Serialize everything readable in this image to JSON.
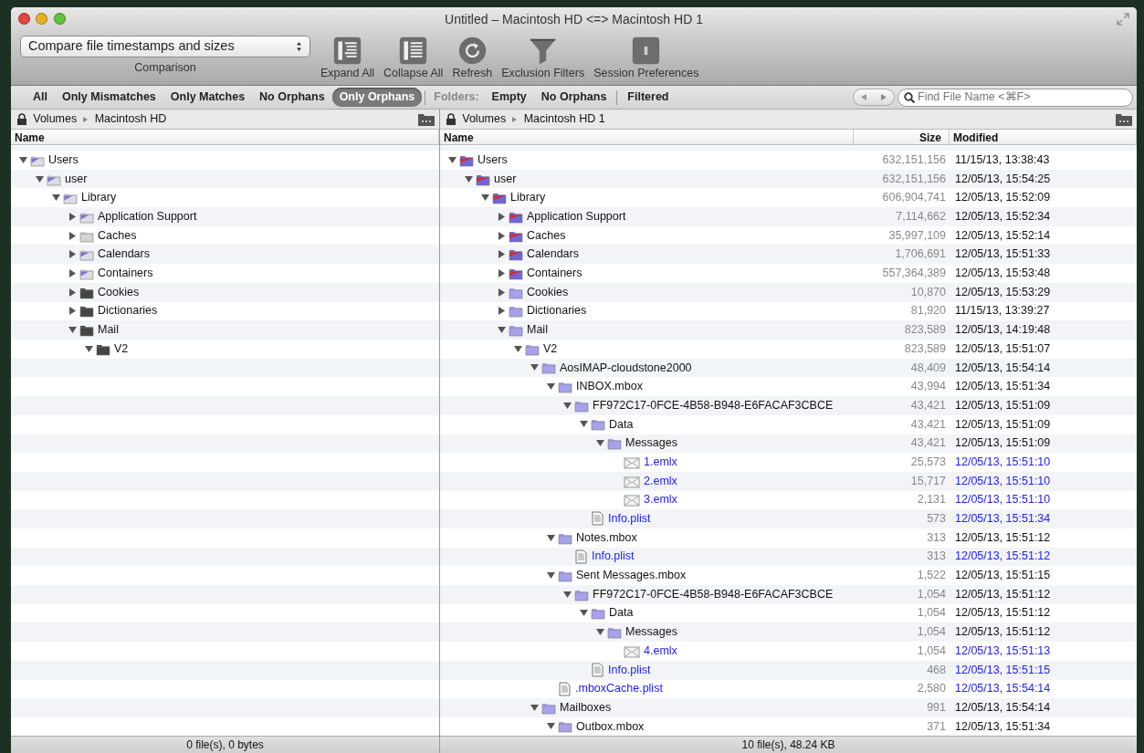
{
  "window": {
    "title": "Untitled – Macintosh HD <=> Macintosh HD 1"
  },
  "toolbar": {
    "comparison": {
      "value": "Compare file timestamps and sizes",
      "label": "Comparison"
    },
    "buttons": [
      {
        "label": "Expand All",
        "kind": "expand"
      },
      {
        "label": "Collapse All",
        "kind": "collapse"
      },
      {
        "label": "Refresh",
        "kind": "refresh"
      },
      {
        "label": "Exclusion Filters",
        "kind": "filter"
      },
      {
        "label": "Session Preferences",
        "kind": "prefs"
      }
    ]
  },
  "filter_bar": {
    "filters": [
      {
        "label": "All",
        "selected": false
      },
      {
        "label": "Only Mismatches",
        "selected": false
      },
      {
        "label": "Only Matches",
        "selected": false
      },
      {
        "label": "No Orphans",
        "selected": false
      },
      {
        "label": "Only Orphans",
        "selected": true
      }
    ],
    "folders_label": "Folders:",
    "folder_filters": [
      {
        "label": "Empty",
        "selected": false
      },
      {
        "label": "No Orphans",
        "selected": false
      }
    ],
    "extra_filters": [
      {
        "label": "Filtered",
        "selected": false
      }
    ],
    "search": {
      "placeholder": "Find File Name <⌘F>"
    }
  },
  "left_pane": {
    "path": [
      "Volumes",
      "Macintosh HD"
    ],
    "columns": [
      "Name"
    ],
    "tree": [
      {
        "name": "Users",
        "kind": "folder",
        "color": "#dcdce4",
        "mismatched": true,
        "expanded": true,
        "children": [
          {
            "name": "user",
            "kind": "folder",
            "color": "#dcdce4",
            "mismatched": true,
            "expanded": true,
            "children": [
              {
                "name": "Library",
                "kind": "folder",
                "color": "#dcdce4",
                "mismatched": true,
                "expanded": true,
                "children": [
                  {
                    "name": "Application Support",
                    "kind": "folder",
                    "color": "#dcdce4",
                    "mismatched": true,
                    "expanded": false
                  },
                  {
                    "name": "Caches",
                    "kind": "folder",
                    "color": "#d4d4d4",
                    "mismatched": false,
                    "expanded": false
                  },
                  {
                    "name": "Calendars",
                    "kind": "folder",
                    "color": "#dcdce4",
                    "mismatched": true,
                    "expanded": false
                  },
                  {
                    "name": "Containers",
                    "kind": "folder",
                    "color": "#dcdce4",
                    "mismatched": true,
                    "expanded": false
                  },
                  {
                    "name": "Cookies",
                    "kind": "folder",
                    "color": "#444444",
                    "mismatched": false,
                    "expanded": false
                  },
                  {
                    "name": "Dictionaries",
                    "kind": "folder",
                    "color": "#444444",
                    "mismatched": false,
                    "expanded": false
                  },
                  {
                    "name": "Mail",
                    "kind": "folder",
                    "color": "#444444",
                    "mismatched": false,
                    "expanded": true,
                    "children": [
                      {
                        "name": "V2",
                        "kind": "folder",
                        "color": "#444444",
                        "mismatched": false,
                        "expanded": true
                      }
                    ]
                  }
                ]
              }
            ]
          }
        ]
      }
    ],
    "status": "0 file(s), 0 bytes"
  },
  "right_pane": {
    "path": [
      "Volumes",
      "Macintosh HD 1"
    ],
    "columns": [
      "Name",
      "Size",
      "Modified"
    ],
    "tree": [
      {
        "name": "Users",
        "kind": "folder",
        "color": "#6f66d8",
        "mismatched": true,
        "expanded": true,
        "orphan": false,
        "size": "632,151,156",
        "modified": "11/15/13, 13:38:43",
        "children": [
          {
            "name": "user",
            "kind": "folder",
            "color": "#6f66d8",
            "mismatched": true,
            "expanded": true,
            "orphan": false,
            "size": "632,151,156",
            "modified": "12/05/13, 15:54:25",
            "children": [
              {
                "name": "Library",
                "kind": "folder",
                "color": "#6f66d8",
                "mismatched": true,
                "expanded": true,
                "orphan": false,
                "size": "606,904,741",
                "modified": "12/05/13, 15:52:09",
                "children": [
                  {
                    "name": "Application Support",
                    "kind": "folder",
                    "color": "#6f66d8",
                    "mismatched": true,
                    "expanded": false,
                    "orphan": false,
                    "size": "7,114,662",
                    "modified": "12/05/13, 15:52:34"
                  },
                  {
                    "name": "Caches",
                    "kind": "folder",
                    "color": "#6f66d8",
                    "mismatched": true,
                    "expanded": false,
                    "orphan": false,
                    "size": "35,997,109",
                    "modified": "12/05/13, 15:52:14"
                  },
                  {
                    "name": "Calendars",
                    "kind": "folder",
                    "color": "#6f66d8",
                    "mismatched": true,
                    "expanded": false,
                    "orphan": false,
                    "size": "1,706,691",
                    "modified": "12/05/13, 15:51:33"
                  },
                  {
                    "name": "Containers",
                    "kind": "folder",
                    "color": "#6f66d8",
                    "mismatched": true,
                    "expanded": false,
                    "orphan": false,
                    "size": "557,364,389",
                    "modified": "12/05/13, 15:53:48"
                  },
                  {
                    "name": "Cookies",
                    "kind": "folder",
                    "color": "#a7a2ec",
                    "mismatched": false,
                    "expanded": false,
                    "orphan": false,
                    "size": "10,870",
                    "modified": "12/05/13, 15:53:29"
                  },
                  {
                    "name": "Dictionaries",
                    "kind": "folder",
                    "color": "#a7a2ec",
                    "mismatched": false,
                    "expanded": false,
                    "orphan": false,
                    "size": "81,920",
                    "modified": "11/15/13, 13:39:27"
                  },
                  {
                    "name": "Mail",
                    "kind": "folder",
                    "color": "#a7a2ec",
                    "mismatched": false,
                    "expanded": true,
                    "orphan": false,
                    "size": "823,589",
                    "modified": "12/05/13, 14:19:48",
                    "children": [
                      {
                        "name": "V2",
                        "kind": "folder",
                        "color": "#a7a2ec",
                        "mismatched": false,
                        "expanded": true,
                        "orphan": false,
                        "size": "823,589",
                        "modified": "12/05/13, 15:51:07",
                        "children": [
                          {
                            "name": "AosIMAP-cloudstone2000",
                            "kind": "folder",
                            "color": "#a7a2ec",
                            "mismatched": false,
                            "expanded": true,
                            "orphan": false,
                            "size": "48,409",
                            "modified": "12/05/13, 15:54:14",
                            "children": [
                              {
                                "name": "INBOX.mbox",
                                "kind": "folder",
                                "color": "#a7a2ec",
                                "mismatched": false,
                                "expanded": true,
                                "orphan": false,
                                "size": "43,994",
                                "modified": "12/05/13, 15:51:34",
                                "children": [
                                  {
                                    "name": "FF972C17-0FCE-4B58-B948-E6FACAF3CBCE",
                                    "kind": "folder",
                                    "color": "#a7a2ec",
                                    "mismatched": false,
                                    "expanded": true,
                                    "orphan": false,
                                    "size": "43,421",
                                    "modified": "12/05/13, 15:51:09",
                                    "children": [
                                      {
                                        "name": "Data",
                                        "kind": "folder",
                                        "color": "#a7a2ec",
                                        "mismatched": false,
                                        "expanded": true,
                                        "orphan": false,
                                        "size": "43,421",
                                        "modified": "12/05/13, 15:51:09",
                                        "children": [
                                          {
                                            "name": "Messages",
                                            "kind": "folder",
                                            "color": "#a7a2ec",
                                            "mismatched": false,
                                            "expanded": true,
                                            "orphan": false,
                                            "size": "43,421",
                                            "modified": "12/05/13, 15:51:09",
                                            "children": [
                                              {
                                                "name": "1.emlx",
                                                "kind": "mail",
                                                "orphan": true,
                                                "size": "25,573",
                                                "modified": "12/05/13, 15:51:10"
                                              },
                                              {
                                                "name": "2.emlx",
                                                "kind": "mail",
                                                "orphan": true,
                                                "size": "15,717",
                                                "modified": "12/05/13, 15:51:10"
                                              },
                                              {
                                                "name": "3.emlx",
                                                "kind": "mail",
                                                "orphan": true,
                                                "size": "2,131",
                                                "modified": "12/05/13, 15:51:10"
                                              }
                                            ]
                                          }
                                        ]
                                      },
                                      {
                                        "name": "Info.plist",
                                        "kind": "document",
                                        "orphan": true,
                                        "size": "573",
                                        "modified": "12/05/13, 15:51:34"
                                      }
                                    ]
                                  }
                                ]
                              },
                              {
                                "name": "Notes.mbox",
                                "kind": "folder",
                                "color": "#a7a2ec",
                                "mismatched": false,
                                "expanded": true,
                                "orphan": false,
                                "size": "313",
                                "modified": "12/05/13, 15:51:12",
                                "children": [
                                  {
                                    "name": "Info.plist",
                                    "kind": "document",
                                    "orphan": true,
                                    "size": "313",
                                    "modified": "12/05/13, 15:51:12"
                                  }
                                ]
                              },
                              {
                                "name": "Sent Messages.mbox",
                                "kind": "folder",
                                "color": "#a7a2ec",
                                "mismatched": false,
                                "expanded": true,
                                "orphan": false,
                                "size": "1,522",
                                "modified": "12/05/13, 15:51:15",
                                "children": [
                                  {
                                    "name": "FF972C17-0FCE-4B58-B948-E6FACAF3CBCE",
                                    "kind": "folder",
                                    "color": "#a7a2ec",
                                    "mismatched": false,
                                    "expanded": true,
                                    "orphan": false,
                                    "size": "1,054",
                                    "modified": "12/05/13, 15:51:12",
                                    "children": [
                                      {
                                        "name": "Data",
                                        "kind": "folder",
                                        "color": "#a7a2ec",
                                        "mismatched": false,
                                        "expanded": true,
                                        "orphan": false,
                                        "size": "1,054",
                                        "modified": "12/05/13, 15:51:12",
                                        "children": [
                                          {
                                            "name": "Messages",
                                            "kind": "folder",
                                            "color": "#a7a2ec",
                                            "mismatched": false,
                                            "expanded": true,
                                            "orphan": false,
                                            "size": "1,054",
                                            "modified": "12/05/13, 15:51:12",
                                            "children": [
                                              {
                                                "name": "4.emlx",
                                                "kind": "mail",
                                                "orphan": true,
                                                "size": "1,054",
                                                "modified": "12/05/13, 15:51:13"
                                              }
                                            ]
                                          }
                                        ]
                                      },
                                      {
                                        "name": "Info.plist",
                                        "kind": "document",
                                        "orphan": true,
                                        "size": "468",
                                        "modified": "12/05/13, 15:51:15"
                                      }
                                    ]
                                  }
                                ]
                              },
                              {
                                "name": ".mboxCache.plist",
                                "kind": "document",
                                "orphan": true,
                                "size": "2,580",
                                "modified": "12/05/13, 15:54:14"
                              }
                            ]
                          },
                          {
                            "name": "Mailboxes",
                            "kind": "folder",
                            "color": "#a7a2ec",
                            "mismatched": false,
                            "expanded": true,
                            "orphan": false,
                            "size": "991",
                            "modified": "12/05/13, 15:54:14",
                            "children": [
                              {
                                "name": "Outbox.mbox",
                                "kind": "folder",
                                "color": "#a7a2ec",
                                "mismatched": false,
                                "expanded": true,
                                "orphan": false,
                                "size": "371",
                                "modified": "12/05/13, 15:51:34"
                              }
                            ]
                          }
                        ]
                      }
                    ]
                  }
                ]
              }
            ]
          }
        ]
      }
    ],
    "status": "10 file(s), 48.24 KB"
  }
}
